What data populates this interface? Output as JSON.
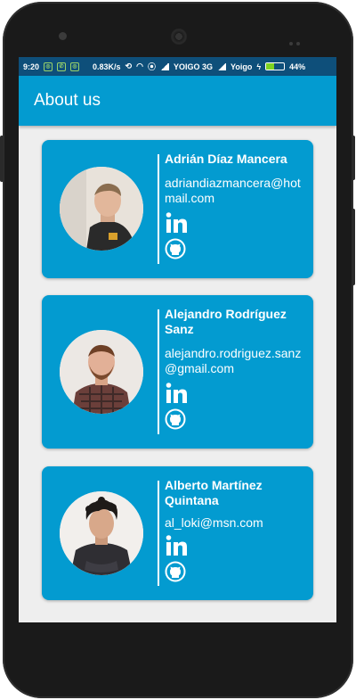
{
  "status_bar": {
    "time": "9:20",
    "speed": "0.83K/s",
    "carrier1": "YOIGO 3G",
    "carrier2": "Yoigo",
    "battery": "44%",
    "battery_level": 0.44
  },
  "app_bar": {
    "title": "About us"
  },
  "colors": {
    "primary": "#039bd0",
    "status": "#0e4f7a",
    "background": "#eeeeee"
  },
  "members": [
    {
      "name": "Adrián Díaz Mancera",
      "email": "adriandiazmancera@hotmail.com",
      "linkedin_icon": "linkedin-icon",
      "github_icon": "github-icon"
    },
    {
      "name": "Alejandro Rodríguez Sanz",
      "email": "alejandro.rodriguez.sanz@gmail.com",
      "linkedin_icon": "linkedin-icon",
      "github_icon": "github-icon"
    },
    {
      "name": "Alberto Martínez Quintana",
      "email": "al_loki@msn.com",
      "linkedin_icon": "linkedin-icon",
      "github_icon": "github-icon"
    }
  ]
}
